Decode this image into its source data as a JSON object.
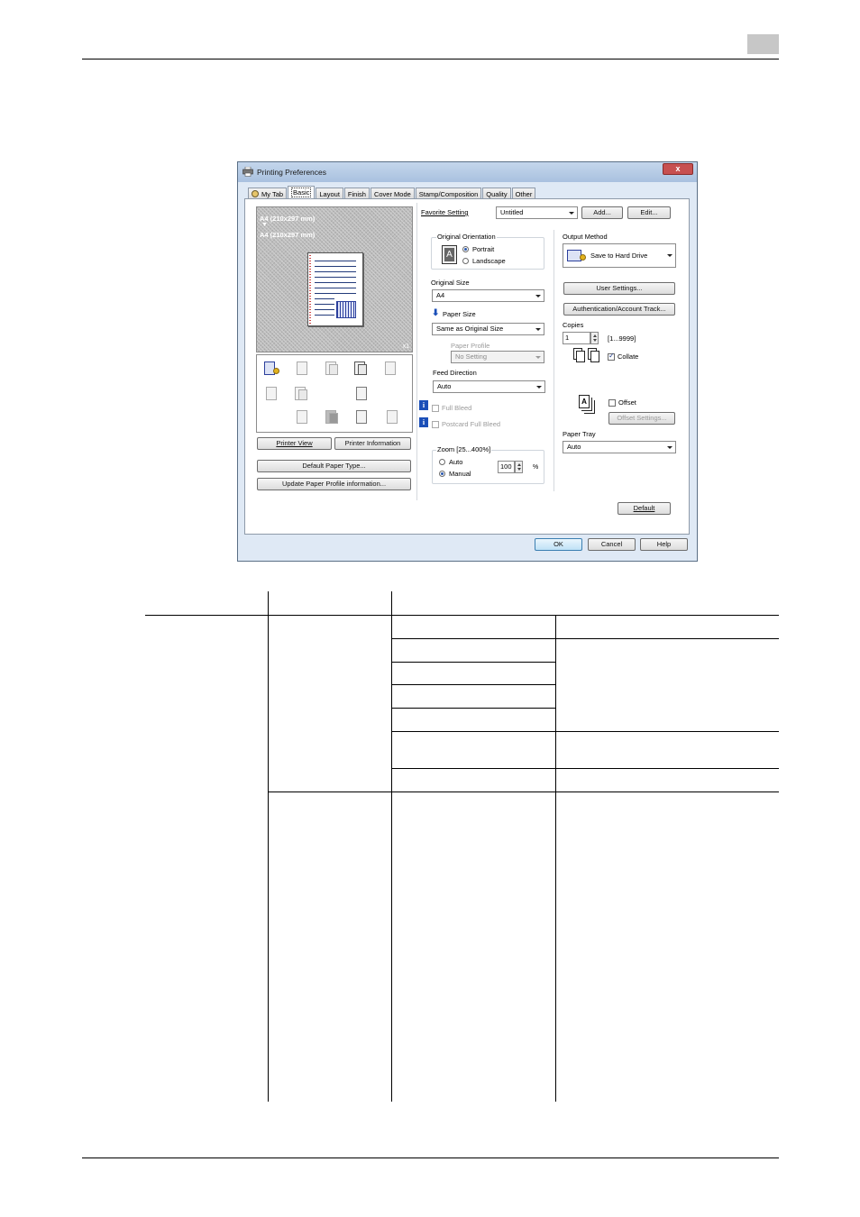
{
  "dialog": {
    "title": "Printing Preferences",
    "close_glyph": "x",
    "tabs": [
      "My Tab",
      "Basic",
      "Layout",
      "Finish",
      "Cover Mode",
      "Stamp/Composition",
      "Quality",
      "Other"
    ],
    "preview": {
      "line1": "A4 (210x297 mm)",
      "arrow": "▼",
      "line2": "A4 (210x297 mm)",
      "copies_mark": "x1"
    },
    "favorite": {
      "label": "Favorite Setting",
      "value": "Untitled",
      "add": "Add...",
      "edit": "Edit..."
    },
    "orientation": {
      "title": "Original Orientation",
      "portrait": "Portrait",
      "landscape": "Landscape",
      "selected": "Portrait"
    },
    "original_size": {
      "label": "Original Size",
      "value": "A4"
    },
    "paper_size": {
      "label": "Paper Size",
      "value": "Same as Original Size"
    },
    "paper_profile": {
      "label": "Paper Profile",
      "value": "No Setting"
    },
    "feed_direction": {
      "label": "Feed Direction",
      "value": "Auto"
    },
    "full_bleed": "Full Bleed",
    "postcard_full_bleed": "Postcard Full Bleed",
    "zoom": {
      "title": "Zoom [25...400%]",
      "auto": "Auto",
      "manual": "Manual",
      "value": "100",
      "unit": "%"
    },
    "output_method": {
      "label": "Output Method",
      "value": "Save to Hard Drive"
    },
    "user_settings": "User Settings...",
    "auth_button": "Authentication/Account Track...",
    "copies": {
      "label": "Copies",
      "value": "1",
      "range": "[1...9999]",
      "collate": "Collate"
    },
    "offset": {
      "label": "Offset",
      "settings": "Offset Settings..."
    },
    "paper_tray": {
      "label": "Paper Tray",
      "value": "Auto"
    },
    "left_buttons": {
      "printer_view": "Printer View",
      "printer_information": "Printer Information",
      "default_paper_type": "Default Paper Type...",
      "update_profile": "Update Paper Profile information..."
    },
    "default_button": "Default",
    "ok": "OK",
    "cancel": "Cancel",
    "help": "Help"
  }
}
